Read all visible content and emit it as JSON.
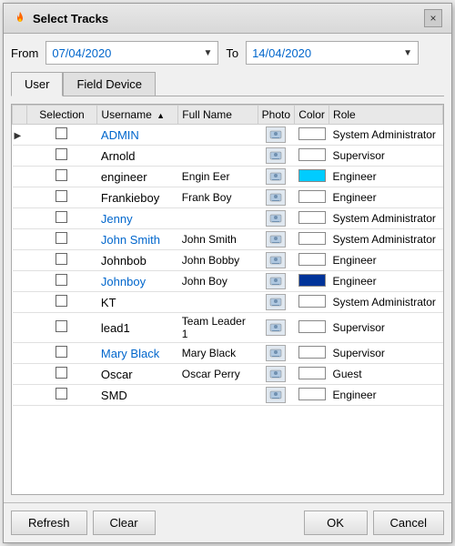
{
  "dialog": {
    "title": "Select Tracks",
    "close_label": "×"
  },
  "date_row": {
    "from_label": "From",
    "from_value": "07/04/2020",
    "to_label": "To",
    "to_value": "14/04/2020"
  },
  "tabs": [
    {
      "id": "user",
      "label": "User",
      "active": true
    },
    {
      "id": "field-device",
      "label": "Field Device",
      "active": false
    }
  ],
  "table": {
    "columns": [
      {
        "id": "selection",
        "label": "Selection"
      },
      {
        "id": "username",
        "label": "Username",
        "sorted": "asc"
      },
      {
        "id": "fullname",
        "label": "Full Name"
      },
      {
        "id": "photo",
        "label": "Photo"
      },
      {
        "id": "color",
        "label": "Color"
      },
      {
        "id": "role",
        "label": "Role"
      }
    ],
    "rows": [
      {
        "username": "ADMIN",
        "fullname": "",
        "role": "System Administrator",
        "color": "#ffffff",
        "checked": false,
        "username_link": true
      },
      {
        "username": "Arnold",
        "fullname": "",
        "role": "Supervisor",
        "color": "#ffffff",
        "checked": false,
        "username_link": false
      },
      {
        "username": "engineer",
        "fullname": "Engin Eer",
        "role": "Engineer",
        "color": "#00ccff",
        "checked": false,
        "username_link": false
      },
      {
        "username": "Frankieboy",
        "fullname": "Frank Boy",
        "role": "Engineer",
        "color": "#ffffff",
        "checked": false,
        "username_link": false
      },
      {
        "username": "Jenny",
        "fullname": "",
        "role": "System Administrator",
        "color": "#ffffff",
        "checked": false,
        "username_link": true
      },
      {
        "username": "John Smith",
        "fullname": "John Smith",
        "role": "System Administrator",
        "color": "#ffffff",
        "checked": false,
        "username_link": true
      },
      {
        "username": "Johnbob",
        "fullname": "John Bobby",
        "role": "Engineer",
        "color": "#ffffff",
        "checked": false,
        "username_link": false
      },
      {
        "username": "Johnboy",
        "fullname": "John Boy",
        "role": "Engineer",
        "color": "#003399",
        "checked": false,
        "username_link": true
      },
      {
        "username": "KT",
        "fullname": "",
        "role": "System Administrator",
        "color": "#ffffff",
        "checked": false,
        "username_link": false
      },
      {
        "username": "lead1",
        "fullname": "Team Leader 1",
        "role": "Supervisor",
        "color": "#ffffff",
        "checked": false,
        "username_link": false
      },
      {
        "username": "Mary Black",
        "fullname": "Mary Black",
        "role": "Supervisor",
        "color": "#ffffff",
        "checked": false,
        "username_link": true
      },
      {
        "username": "Oscar",
        "fullname": "Oscar Perry",
        "role": "Guest",
        "color": "#ffffff",
        "checked": false,
        "username_link": false
      },
      {
        "username": "SMD",
        "fullname": "",
        "role": "Engineer",
        "color": "#ffffff",
        "checked": false,
        "username_link": false
      }
    ]
  },
  "buttons": {
    "refresh": "Refresh",
    "clear": "Clear",
    "ok": "OK",
    "cancel": "Cancel"
  }
}
